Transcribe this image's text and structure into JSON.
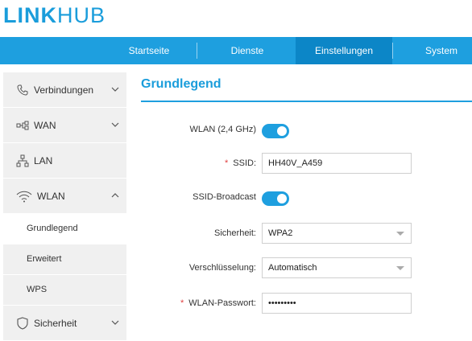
{
  "logo": {
    "bold": "LINK",
    "light": "HUB"
  },
  "nav": {
    "tabs": [
      "Startseite",
      "Dienste",
      "Einstellungen",
      "System"
    ],
    "active": "Einstellungen"
  },
  "sidebar": {
    "items": [
      {
        "label": "Verbindungen",
        "icon": "phone-icon",
        "expanded": false
      },
      {
        "label": "WAN",
        "icon": "wan-icon",
        "expanded": false
      },
      {
        "label": "LAN",
        "icon": "lan-icon"
      },
      {
        "label": "WLAN",
        "icon": "wifi-icon",
        "expanded": true
      },
      {
        "label": "Sicherheit",
        "icon": "shield-icon",
        "expanded": false
      }
    ],
    "wlan_sub": [
      "Grundlegend",
      "Erweitert",
      "WPS"
    ],
    "active_sub": "Grundlegend"
  },
  "main": {
    "title": "Grundlegend",
    "wlan_label": "WLAN (2,4 GHz)",
    "wlan_on": true,
    "ssid_label": "SSID:",
    "ssid_value": "HH40V_A459",
    "broadcast_label": "SSID-Broadcast",
    "broadcast_on": true,
    "security_label": "Sicherheit:",
    "security_value": "WPA2",
    "encryption_label": "Verschlüsselung:",
    "encryption_value": "Automatisch",
    "password_label": "WLAN-Passwort:",
    "password_value": "•••••••••",
    "required_mark": "*"
  },
  "colors": {
    "accent": "#1e9fdf",
    "accent_dark": "#0c86c7",
    "required": "#e04040"
  }
}
